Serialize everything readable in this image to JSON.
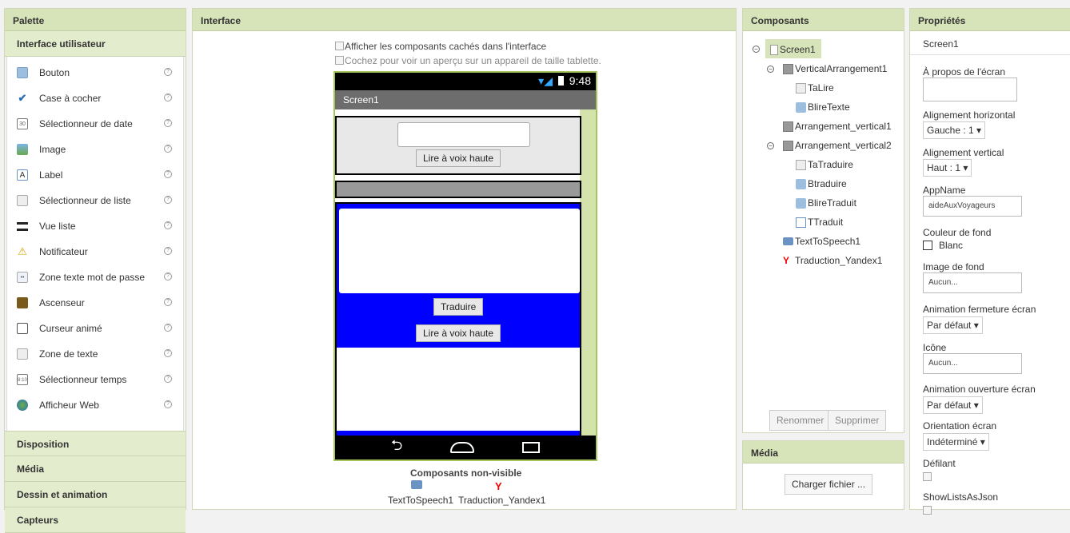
{
  "palette": {
    "title": "Palette",
    "section": "Interface utilisateur",
    "items": [
      {
        "label": "Bouton",
        "icon": "button-icon"
      },
      {
        "label": "Case à cocher",
        "icon": "checkbox-icon"
      },
      {
        "label": "Sélectionneur de date",
        "icon": "date-picker-icon"
      },
      {
        "label": "Image",
        "icon": "image-icon"
      },
      {
        "label": "Label",
        "icon": "label-icon"
      },
      {
        "label": "Sélectionneur de liste",
        "icon": "list-picker-icon"
      },
      {
        "label": "Vue liste",
        "icon": "list-view-icon"
      },
      {
        "label": "Notificateur",
        "icon": "notifier-icon"
      },
      {
        "label": "Zone texte mot de passe",
        "icon": "password-icon"
      },
      {
        "label": "Ascenseur",
        "icon": "slider-icon"
      },
      {
        "label": "Curseur animé",
        "icon": "spinner-icon"
      },
      {
        "label": "Zone de texte",
        "icon": "textbox-icon"
      },
      {
        "label": "Sélectionneur temps",
        "icon": "time-picker-icon"
      },
      {
        "label": "Afficheur Web",
        "icon": "web-viewer-icon"
      }
    ],
    "help_glyph": "?",
    "sections": [
      "Disposition",
      "Média",
      "Dessin et animation",
      "Capteurs"
    ]
  },
  "interface": {
    "title": "Interface",
    "show_hidden": "Afficher les composants cachés dans l'interface",
    "tablet_preview": "Cochez pour voir un aperçu sur un appareil de taille tablette.",
    "status_time": "9:48",
    "screen_title": "Screen1",
    "btn_lire1": "Lire à voix haute",
    "btn_traduire": "Traduire",
    "btn_lire2": "Lire à voix haute",
    "nonvisible_title": "Composants non-visible",
    "nonvisible": [
      "TextToSpeech1",
      "Traduction_Yandex1"
    ]
  },
  "components": {
    "title": "Composants",
    "tree": [
      "Screen1",
      "VerticalArrangement1",
      "TaLire",
      "BlireTexte",
      "Arrangement_vertical1",
      "Arrangement_vertical2",
      "TaTraduire",
      "Btraduire",
      "BlireTraduit",
      "TTraduit",
      "TextToSpeech1",
      "Traduction_Yandex1"
    ],
    "rename": "Renommer",
    "delete": "Supprimer"
  },
  "media": {
    "title": "Média",
    "upload": "Charger fichier ..."
  },
  "properties": {
    "title": "Propriétés",
    "component": "Screen1",
    "about_label": "À propos de l'écran",
    "halign_label": "Alignement horizontal",
    "halign_value": "Gauche : 1 ▾",
    "valign_label": "Alignement vertical",
    "valign_value": "Haut : 1 ▾",
    "appname_label": "AppName",
    "appname_value": "aideAuxVoyageurs",
    "bgcolor_label": "Couleur de fond",
    "bgcolor_value": "Blanc",
    "bgimage_label": "Image de fond",
    "bgimage_value": "Aucun...",
    "close_anim_label": "Animation fermeture écran",
    "close_anim_value": "Par défaut ▾",
    "icon_label": "Icône",
    "icon_value": "Aucun...",
    "open_anim_label": "Animation ouverture écran",
    "open_anim_value": "Par défaut ▾",
    "orientation_label": "Orientation écran",
    "orientation_value": "Indéterminé ▾",
    "scroll_label": "Défilant",
    "showlists_label": "ShowListsAsJson"
  },
  "colors": {
    "header": "#d7e3b8",
    "phone_border": "#a5c45c",
    "blue": "#0000ff"
  }
}
